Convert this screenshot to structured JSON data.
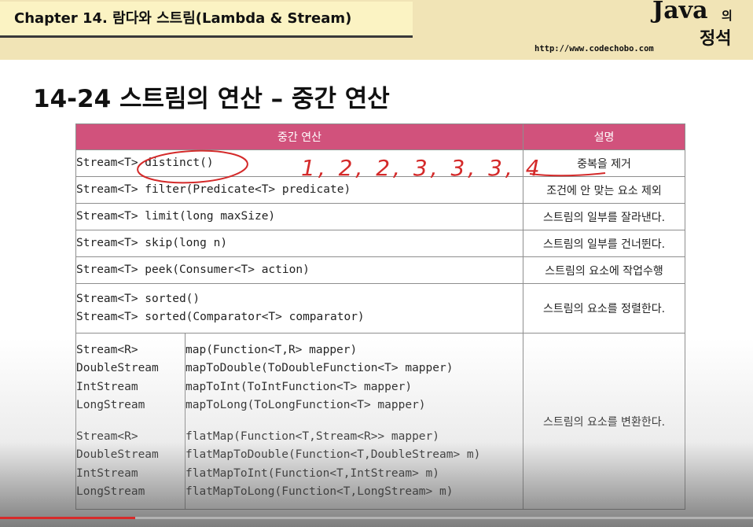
{
  "header": {
    "chapter": "Chapter 14. 람다와 스트림(Lambda & Stream)",
    "brand_java": "Java",
    "brand_ui": "의",
    "brand_jeongseok": "정석",
    "url": "http://www.codechobo.com"
  },
  "slide": {
    "title": "14-24 스트림의 연산 – 중간 연산"
  },
  "table": {
    "col_op": "중간 연산",
    "col_desc": "설명",
    "rows": [
      {
        "op": "Stream<T> distinct()",
        "desc": "중복을 제거"
      },
      {
        "op": "Stream<T> filter(Predicate<T> predicate)",
        "desc": "조건에 안 맞는 요소 제외"
      },
      {
        "op": "Stream<T> limit(long maxSize)",
        "desc": "스트림의 일부를 잘라낸다."
      },
      {
        "op": "Stream<T> skip(long n)",
        "desc": "스트림의 일부를 건너뛴다."
      },
      {
        "op": "Stream<T> peek(Consumer<T> action)",
        "desc": "스트림의 요소에 작업수행"
      },
      {
        "op1": "Stream<T> sorted()",
        "op2": "Stream<T> sorted(Comparator<T> comparator)",
        "desc": "스트림의 요소를 정렬한다."
      }
    ],
    "map_block": {
      "types": [
        "Stream<R>",
        "DoubleStream",
        "IntStream",
        "LongStream",
        "Stream<R>",
        "DoubleStream",
        "IntStream",
        "LongStream"
      ],
      "methods": [
        "map(Function<T,R> mapper)",
        "mapToDouble(ToDoubleFunction<T> mapper)",
        "mapToInt(ToIntFunction<T> mapper)",
        "mapToLong(ToLongFunction<T> mapper)",
        "flatMap(Function<T,Stream<R>> mapper)",
        "flatMapToDouble(Function<T,DoubleStream> m)",
        "flatMapToInt(Function<T,IntStream> m)",
        "flatMapToLong(Function<T,LongStream> m)"
      ],
      "desc": "스트림의 요소를 변환한다."
    }
  },
  "annotation": {
    "handwritten": "1, 2, 2, 3, 3, 3, 4"
  },
  "colors": {
    "header_bg": "#f1e4b6",
    "table_header": "#d1527c",
    "ink_red": "#d42a2a"
  },
  "playback": {
    "progress": 0.18
  }
}
